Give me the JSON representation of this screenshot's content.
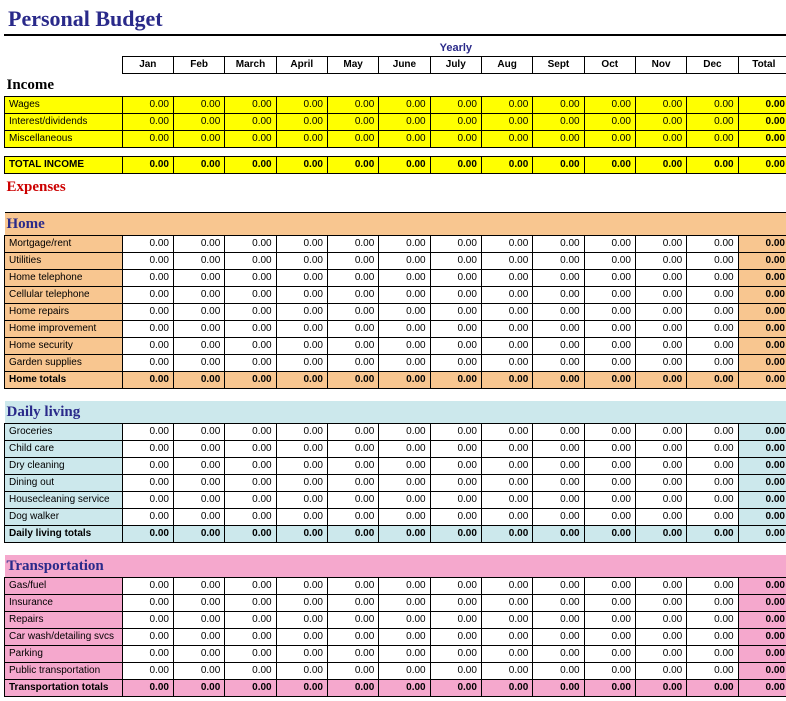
{
  "title": "Personal Budget",
  "yearly_label": "Yearly",
  "months": [
    "Jan",
    "Feb",
    "March",
    "April",
    "May",
    "June",
    "July",
    "Aug",
    "Sept",
    "Oct",
    "Nov",
    "Dec"
  ],
  "total_label": "Total",
  "income": {
    "heading": "Income",
    "rows": [
      {
        "label": "Wages",
        "vals": [
          "0.00",
          "0.00",
          "0.00",
          "0.00",
          "0.00",
          "0.00",
          "0.00",
          "0.00",
          "0.00",
          "0.00",
          "0.00",
          "0.00",
          "0.00"
        ]
      },
      {
        "label": "Interest/dividends",
        "vals": [
          "0.00",
          "0.00",
          "0.00",
          "0.00",
          "0.00",
          "0.00",
          "0.00",
          "0.00",
          "0.00",
          "0.00",
          "0.00",
          "0.00",
          "0.00"
        ]
      },
      {
        "label": "Miscellaneous",
        "vals": [
          "0.00",
          "0.00",
          "0.00",
          "0.00",
          "0.00",
          "0.00",
          "0.00",
          "0.00",
          "0.00",
          "0.00",
          "0.00",
          "0.00",
          "0.00"
        ]
      }
    ],
    "total": {
      "label": "TOTAL INCOME",
      "vals": [
        "0.00",
        "0.00",
        "0.00",
        "0.00",
        "0.00",
        "0.00",
        "0.00",
        "0.00",
        "0.00",
        "0.00",
        "0.00",
        "0.00",
        "0.00"
      ]
    }
  },
  "expenses_heading": "Expenses",
  "categories": [
    {
      "heading": "Home",
      "bg": "bg-orange",
      "rows": [
        {
          "label": "Mortgage/rent",
          "vals": [
            "0.00",
            "0.00",
            "0.00",
            "0.00",
            "0.00",
            "0.00",
            "0.00",
            "0.00",
            "0.00",
            "0.00",
            "0.00",
            "0.00",
            "0.00"
          ]
        },
        {
          "label": "Utilities",
          "vals": [
            "0.00",
            "0.00",
            "0.00",
            "0.00",
            "0.00",
            "0.00",
            "0.00",
            "0.00",
            "0.00",
            "0.00",
            "0.00",
            "0.00",
            "0.00"
          ]
        },
        {
          "label": "Home telephone",
          "vals": [
            "0.00",
            "0.00",
            "0.00",
            "0.00",
            "0.00",
            "0.00",
            "0.00",
            "0.00",
            "0.00",
            "0.00",
            "0.00",
            "0.00",
            "0.00"
          ]
        },
        {
          "label": "Cellular telephone",
          "vals": [
            "0.00",
            "0.00",
            "0.00",
            "0.00",
            "0.00",
            "0.00",
            "0.00",
            "0.00",
            "0.00",
            "0.00",
            "0.00",
            "0.00",
            "0.00"
          ]
        },
        {
          "label": "Home repairs",
          "vals": [
            "0.00",
            "0.00",
            "0.00",
            "0.00",
            "0.00",
            "0.00",
            "0.00",
            "0.00",
            "0.00",
            "0.00",
            "0.00",
            "0.00",
            "0.00"
          ]
        },
        {
          "label": "Home improvement",
          "vals": [
            "0.00",
            "0.00",
            "0.00",
            "0.00",
            "0.00",
            "0.00",
            "0.00",
            "0.00",
            "0.00",
            "0.00",
            "0.00",
            "0.00",
            "0.00"
          ]
        },
        {
          "label": "Home security",
          "vals": [
            "0.00",
            "0.00",
            "0.00",
            "0.00",
            "0.00",
            "0.00",
            "0.00",
            "0.00",
            "0.00",
            "0.00",
            "0.00",
            "0.00",
            "0.00"
          ]
        },
        {
          "label": "Garden supplies",
          "vals": [
            "0.00",
            "0.00",
            "0.00",
            "0.00",
            "0.00",
            "0.00",
            "0.00",
            "0.00",
            "0.00",
            "0.00",
            "0.00",
            "0.00",
            "0.00"
          ]
        }
      ],
      "total": {
        "label": "Home totals",
        "vals": [
          "0.00",
          "0.00",
          "0.00",
          "0.00",
          "0.00",
          "0.00",
          "0.00",
          "0.00",
          "0.00",
          "0.00",
          "0.00",
          "0.00",
          "0.00"
        ]
      }
    },
    {
      "heading": "Daily living",
      "bg": "bg-cyan",
      "rows": [
        {
          "label": "Groceries",
          "vals": [
            "0.00",
            "0.00",
            "0.00",
            "0.00",
            "0.00",
            "0.00",
            "0.00",
            "0.00",
            "0.00",
            "0.00",
            "0.00",
            "0.00",
            "0.00"
          ]
        },
        {
          "label": "Child care",
          "vals": [
            "0.00",
            "0.00",
            "0.00",
            "0.00",
            "0.00",
            "0.00",
            "0.00",
            "0.00",
            "0.00",
            "0.00",
            "0.00",
            "0.00",
            "0.00"
          ]
        },
        {
          "label": "Dry cleaning",
          "vals": [
            "0.00",
            "0.00",
            "0.00",
            "0.00",
            "0.00",
            "0.00",
            "0.00",
            "0.00",
            "0.00",
            "0.00",
            "0.00",
            "0.00",
            "0.00"
          ]
        },
        {
          "label": "Dining out",
          "vals": [
            "0.00",
            "0.00",
            "0.00",
            "0.00",
            "0.00",
            "0.00",
            "0.00",
            "0.00",
            "0.00",
            "0.00",
            "0.00",
            "0.00",
            "0.00"
          ]
        },
        {
          "label": "Housecleaning service",
          "vals": [
            "0.00",
            "0.00",
            "0.00",
            "0.00",
            "0.00",
            "0.00",
            "0.00",
            "0.00",
            "0.00",
            "0.00",
            "0.00",
            "0.00",
            "0.00"
          ]
        },
        {
          "label": "Dog walker",
          "vals": [
            "0.00",
            "0.00",
            "0.00",
            "0.00",
            "0.00",
            "0.00",
            "0.00",
            "0.00",
            "0.00",
            "0.00",
            "0.00",
            "0.00",
            "0.00"
          ]
        }
      ],
      "total": {
        "label": "Daily living totals",
        "vals": [
          "0.00",
          "0.00",
          "0.00",
          "0.00",
          "0.00",
          "0.00",
          "0.00",
          "0.00",
          "0.00",
          "0.00",
          "0.00",
          "0.00",
          "0.00"
        ]
      }
    },
    {
      "heading": "Transportation",
      "bg": "bg-pink",
      "rows": [
        {
          "label": "Gas/fuel",
          "vals": [
            "0.00",
            "0.00",
            "0.00",
            "0.00",
            "0.00",
            "0.00",
            "0.00",
            "0.00",
            "0.00",
            "0.00",
            "0.00",
            "0.00",
            "0.00"
          ]
        },
        {
          "label": "Insurance",
          "vals": [
            "0.00",
            "0.00",
            "0.00",
            "0.00",
            "0.00",
            "0.00",
            "0.00",
            "0.00",
            "0.00",
            "0.00",
            "0.00",
            "0.00",
            "0.00"
          ]
        },
        {
          "label": "Repairs",
          "vals": [
            "0.00",
            "0.00",
            "0.00",
            "0.00",
            "0.00",
            "0.00",
            "0.00",
            "0.00",
            "0.00",
            "0.00",
            "0.00",
            "0.00",
            "0.00"
          ]
        },
        {
          "label": "Car wash/detailing svcs",
          "vals": [
            "0.00",
            "0.00",
            "0.00",
            "0.00",
            "0.00",
            "0.00",
            "0.00",
            "0.00",
            "0.00",
            "0.00",
            "0.00",
            "0.00",
            "0.00"
          ]
        },
        {
          "label": "Parking",
          "vals": [
            "0.00",
            "0.00",
            "0.00",
            "0.00",
            "0.00",
            "0.00",
            "0.00",
            "0.00",
            "0.00",
            "0.00",
            "0.00",
            "0.00",
            "0.00"
          ]
        },
        {
          "label": "Public transportation",
          "vals": [
            "0.00",
            "0.00",
            "0.00",
            "0.00",
            "0.00",
            "0.00",
            "0.00",
            "0.00",
            "0.00",
            "0.00",
            "0.00",
            "0.00",
            "0.00"
          ]
        }
      ],
      "total": {
        "label": "Transportation totals",
        "vals": [
          "0.00",
          "0.00",
          "0.00",
          "0.00",
          "0.00",
          "0.00",
          "0.00",
          "0.00",
          "0.00",
          "0.00",
          "0.00",
          "0.00",
          "0.00"
        ]
      }
    }
  ],
  "chart_data": {
    "type": "table",
    "title": "Personal Budget",
    "columns": [
      "Jan",
      "Feb",
      "March",
      "April",
      "May",
      "June",
      "July",
      "Aug",
      "Sept",
      "Oct",
      "Nov",
      "Dec",
      "Total"
    ],
    "sections": [
      {
        "name": "Income",
        "rows": [
          "Wages",
          "Interest/dividends",
          "Miscellaneous"
        ],
        "total_row": "TOTAL INCOME"
      },
      {
        "name": "Home",
        "rows": [
          "Mortgage/rent",
          "Utilities",
          "Home telephone",
          "Cellular telephone",
          "Home repairs",
          "Home improvement",
          "Home security",
          "Garden supplies"
        ],
        "total_row": "Home totals"
      },
      {
        "name": "Daily living",
        "rows": [
          "Groceries",
          "Child care",
          "Dry cleaning",
          "Dining out",
          "Housecleaning service",
          "Dog walker"
        ],
        "total_row": "Daily living totals"
      },
      {
        "name": "Transportation",
        "rows": [
          "Gas/fuel",
          "Insurance",
          "Repairs",
          "Car wash/detailing svcs",
          "Parking",
          "Public transportation"
        ],
        "total_row": "Transportation totals"
      }
    ],
    "note": "All values 0.00"
  }
}
